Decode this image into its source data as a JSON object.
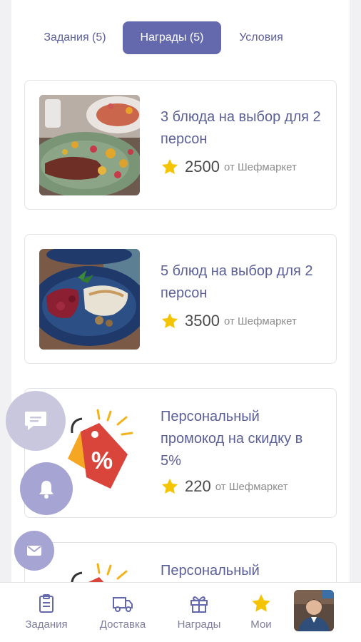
{
  "tabs": [
    {
      "label": "Задания (5)"
    },
    {
      "label": "Награды (5)",
      "active": true
    },
    {
      "label": "Условия"
    }
  ],
  "rewards": [
    {
      "title": "3 блюда на выбор для 2 персон",
      "price": "2500",
      "from": "от Шефмаркет",
      "image": "steak-dish"
    },
    {
      "title": "5 блюд на выбор для 2 персон",
      "price": "3500",
      "from": "от Шефмаркет",
      "image": "fish-dish"
    },
    {
      "title": "Персональный промокод на скидку в 5%",
      "price": "220",
      "from": "от Шефмаркет",
      "image": "discount-tag"
    },
    {
      "title": "Персональный",
      "image": "discount-tag"
    }
  ],
  "fab": {
    "chat_icon": "chat-icon",
    "bell_icon": "bell-icon",
    "mail_icon": "mail-icon"
  },
  "nav": [
    {
      "label": "Задания",
      "icon": "clipboard-icon"
    },
    {
      "label": "Доставка",
      "icon": "truck-icon"
    },
    {
      "label": "Награды",
      "icon": "gift-icon"
    },
    {
      "label": "Мои",
      "icon": "star-icon",
      "active": true
    }
  ],
  "colors": {
    "accent": "#6469ad",
    "title": "#5b5f97",
    "star": "#f5c400",
    "fab": "#a6a4d2"
  }
}
